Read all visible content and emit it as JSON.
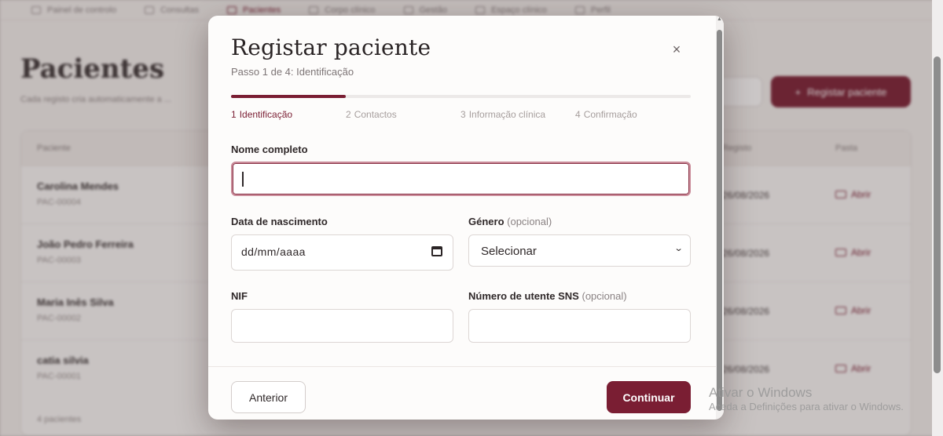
{
  "background": {
    "nav": [
      "Painel de controlo",
      "Consultas",
      "Pacientes",
      "Corpo clínico",
      "Gestão",
      "Espaço clínico",
      "Perfil"
    ],
    "page_title": "Pacientes",
    "page_subtitle": "Cada registo cria automaticamente a ...",
    "register_button": "Registar paciente",
    "table": {
      "col_patient": "Paciente",
      "col_registry": "Registo",
      "col_folder": "Pasta",
      "rows": [
        {
          "name": "Carolina Mendes",
          "id": "PAC-00004",
          "date": "26/08/2026",
          "action": "Abrir"
        },
        {
          "name": "João Pedro Ferreira",
          "id": "PAC-00003",
          "date": "26/08/2026",
          "action": "Abrir"
        },
        {
          "name": "Maria Inês Silva",
          "id": "PAC-00002",
          "date": "26/08/2026",
          "action": "Abrir"
        },
        {
          "name": "catia silvia",
          "id": "PAC-00001",
          "date": "26/08/2026",
          "action": "Abrir"
        }
      ],
      "count": "4 pacientes"
    }
  },
  "modal": {
    "title": "Registar paciente",
    "step_info": "Passo 1 de 4: Identificação",
    "close_glyph": "×",
    "progress_percent": 25,
    "steps": [
      {
        "num": "1",
        "label": "Identificação"
      },
      {
        "num": "2",
        "label": "Contactos"
      },
      {
        "num": "3",
        "label": "Informação clínica"
      },
      {
        "num": "4",
        "label": "Confirmação"
      }
    ],
    "fields": {
      "full_name": {
        "label": "Nome completo",
        "value": ""
      },
      "birth_date": {
        "label": "Data de nascimento",
        "placeholder": "dd/mm/aaaa"
      },
      "gender": {
        "label": "Género",
        "optional": "(opcional)",
        "selected": "Selecionar"
      },
      "nif": {
        "label": "NIF",
        "value": ""
      },
      "sns": {
        "label": "Número de utente SNS",
        "optional": "(opcional)",
        "value": ""
      }
    },
    "buttons": {
      "previous": "Anterior",
      "continue": "Continuar"
    }
  },
  "watermark": {
    "line1": "Ativar o Windows",
    "line2": "Aceda a Definições para ativar o Windows."
  },
  "colors": {
    "accent": "#7a1e33",
    "focus_border": "#c98a98"
  }
}
